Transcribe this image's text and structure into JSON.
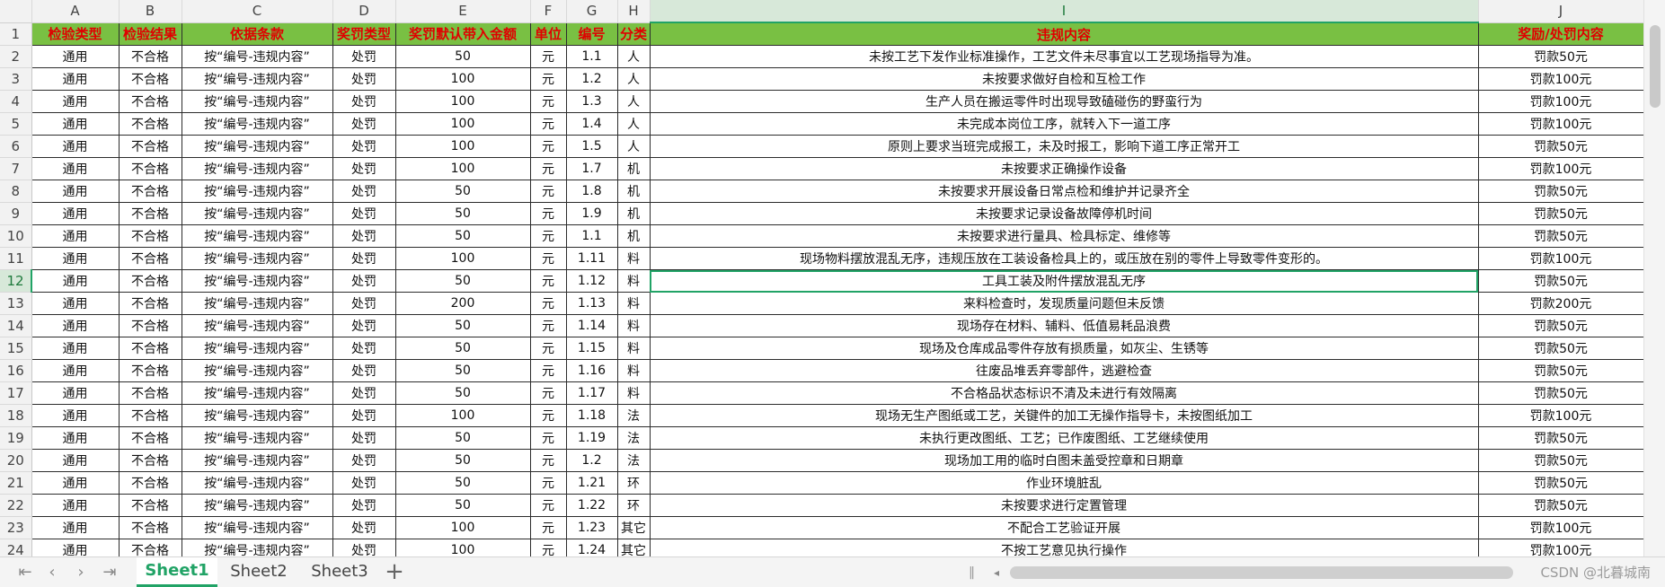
{
  "columns": [
    "A",
    "B",
    "C",
    "D",
    "E",
    "F",
    "G",
    "H",
    "I",
    "J"
  ],
  "header_row": {
    "num": "1",
    "cells": [
      "检验类型",
      "检验结果",
      "依据条款",
      "奖罚类型",
      "奖罚默认带入金额",
      "单位",
      "编号",
      "分类",
      "违规内容",
      "奖励/处罚内容"
    ]
  },
  "rows": [
    {
      "num": "2",
      "cells": [
        "通用",
        "不合格",
        "按“编号-违规内容”",
        "处罚",
        "50",
        "元",
        "1.1",
        "人",
        "未按工艺下发作业标准操作，工艺文件未尽事宜以工艺现场指导为准。",
        "罚款50元"
      ]
    },
    {
      "num": "3",
      "cells": [
        "通用",
        "不合格",
        "按“编号-违规内容”",
        "处罚",
        "100",
        "元",
        "1.2",
        "人",
        "未按要求做好自检和互检工作",
        "罚款100元"
      ]
    },
    {
      "num": "4",
      "cells": [
        "通用",
        "不合格",
        "按“编号-违规内容”",
        "处罚",
        "100",
        "元",
        "1.3",
        "人",
        "生产人员在搬运零件时出现导致磕碰伤的野蛮行为",
        "罚款100元"
      ]
    },
    {
      "num": "5",
      "cells": [
        "通用",
        "不合格",
        "按“编号-违规内容”",
        "处罚",
        "100",
        "元",
        "1.4",
        "人",
        "未完成本岗位工序，就转入下一道工序",
        "罚款100元"
      ]
    },
    {
      "num": "6",
      "cells": [
        "通用",
        "不合格",
        "按“编号-违规内容”",
        "处罚",
        "100",
        "元",
        "1.5",
        "人",
        "原则上要求当班完成报工，未及时报工，影响下道工序正常开工",
        "罚款50元"
      ]
    },
    {
      "num": "7",
      "cells": [
        "通用",
        "不合格",
        "按“编号-违规内容”",
        "处罚",
        "100",
        "元",
        "1.7",
        "机",
        "未按要求正确操作设备",
        "罚款100元"
      ]
    },
    {
      "num": "8",
      "cells": [
        "通用",
        "不合格",
        "按“编号-违规内容”",
        "处罚",
        "50",
        "元",
        "1.8",
        "机",
        "未按要求开展设备日常点检和维护并记录齐全",
        "罚款50元"
      ]
    },
    {
      "num": "9",
      "cells": [
        "通用",
        "不合格",
        "按“编号-违规内容”",
        "处罚",
        "50",
        "元",
        "1.9",
        "机",
        "未按要求记录设备故障停机时间",
        "罚款50元"
      ]
    },
    {
      "num": "10",
      "cells": [
        "通用",
        "不合格",
        "按“编号-违规内容”",
        "处罚",
        "50",
        "元",
        "1.1",
        "机",
        "未按要求进行量具、检具标定、维修等",
        "罚款50元"
      ]
    },
    {
      "num": "11",
      "cells": [
        "通用",
        "不合格",
        "按“编号-违规内容”",
        "处罚",
        "100",
        "元",
        "1.11",
        "料",
        "现场物料摆放混乱无序，违规压放在工装设备检具上的，或压放在别的零件上导致零件变形的。",
        "罚款100元"
      ]
    },
    {
      "num": "12",
      "cells": [
        "通用",
        "不合格",
        "按“编号-违规内容”",
        "处罚",
        "50",
        "元",
        "1.12",
        "料",
        "工具工装及附件摆放混乱无序",
        "罚款50元"
      ]
    },
    {
      "num": "13",
      "cells": [
        "通用",
        "不合格",
        "按“编号-违规内容”",
        "处罚",
        "200",
        "元",
        "1.13",
        "料",
        "来料检查时，发现质量问题但未反馈",
        "罚款200元"
      ]
    },
    {
      "num": "14",
      "cells": [
        "通用",
        "不合格",
        "按“编号-违规内容”",
        "处罚",
        "50",
        "元",
        "1.14",
        "料",
        "现场存在材料、辅料、低值易耗品浪费",
        "罚款50元"
      ]
    },
    {
      "num": "15",
      "cells": [
        "通用",
        "不合格",
        "按“编号-违规内容”",
        "处罚",
        "50",
        "元",
        "1.15",
        "料",
        "现场及仓库成品零件存放有损质量，如灰尘、生锈等",
        "罚款50元"
      ]
    },
    {
      "num": "16",
      "cells": [
        "通用",
        "不合格",
        "按“编号-违规内容”",
        "处罚",
        "50",
        "元",
        "1.16",
        "料",
        "往废品堆丢弃零部件，逃避检查",
        "罚款50元"
      ]
    },
    {
      "num": "17",
      "cells": [
        "通用",
        "不合格",
        "按“编号-违规内容”",
        "处罚",
        "50",
        "元",
        "1.17",
        "料",
        "不合格品状态标识不清及未进行有效隔离",
        "罚款50元"
      ]
    },
    {
      "num": "18",
      "cells": [
        "通用",
        "不合格",
        "按“编号-违规内容”",
        "处罚",
        "100",
        "元",
        "1.18",
        "法",
        "现场无生产图纸或工艺，关键件的加工无操作指导卡，未按图纸加工",
        "罚款100元"
      ]
    },
    {
      "num": "19",
      "cells": [
        "通用",
        "不合格",
        "按“编号-违规内容”",
        "处罚",
        "50",
        "元",
        "1.19",
        "法",
        "未执行更改图纸、工艺；已作废图纸、工艺继续使用",
        "罚款50元"
      ]
    },
    {
      "num": "20",
      "cells": [
        "通用",
        "不合格",
        "按“编号-违规内容”",
        "处罚",
        "50",
        "元",
        "1.2",
        "法",
        "现场加工用的临时白图未盖受控章和日期章",
        "罚款50元"
      ]
    },
    {
      "num": "21",
      "cells": [
        "通用",
        "不合格",
        "按“编号-违规内容”",
        "处罚",
        "50",
        "元",
        "1.21",
        "环",
        "作业环境脏乱",
        "罚款50元"
      ]
    },
    {
      "num": "22",
      "cells": [
        "通用",
        "不合格",
        "按“编号-违规内容”",
        "处罚",
        "50",
        "元",
        "1.22",
        "环",
        "未按要求进行定置管理",
        "罚款50元"
      ]
    },
    {
      "num": "23",
      "cells": [
        "通用",
        "不合格",
        "按“编号-违规内容”",
        "处罚",
        "100",
        "元",
        "1.23",
        "其它",
        "不配合工艺验证开展",
        "罚款100元"
      ]
    },
    {
      "num": "24",
      "cells": [
        "通用",
        "不合格",
        "按“编号-违规内容”",
        "处罚",
        "100",
        "元",
        "1.24",
        "其它",
        "不按工艺意见执行操作",
        "罚款100元"
      ]
    }
  ],
  "selection": {
    "row": "12",
    "column": "I"
  },
  "sheets": [
    {
      "label": "Sheet1",
      "active": true
    },
    {
      "label": "Sheet2",
      "active": false
    },
    {
      "label": "Sheet3",
      "active": false
    }
  ],
  "nav": {
    "first": "⇤",
    "prev": "‹",
    "next": "›",
    "last": "⇥",
    "add": "+"
  },
  "watermark": "CSDN @北暮城南",
  "colors": {
    "header_fill": "#79c043",
    "header_text": "#e00000",
    "accent": "#21a366"
  }
}
